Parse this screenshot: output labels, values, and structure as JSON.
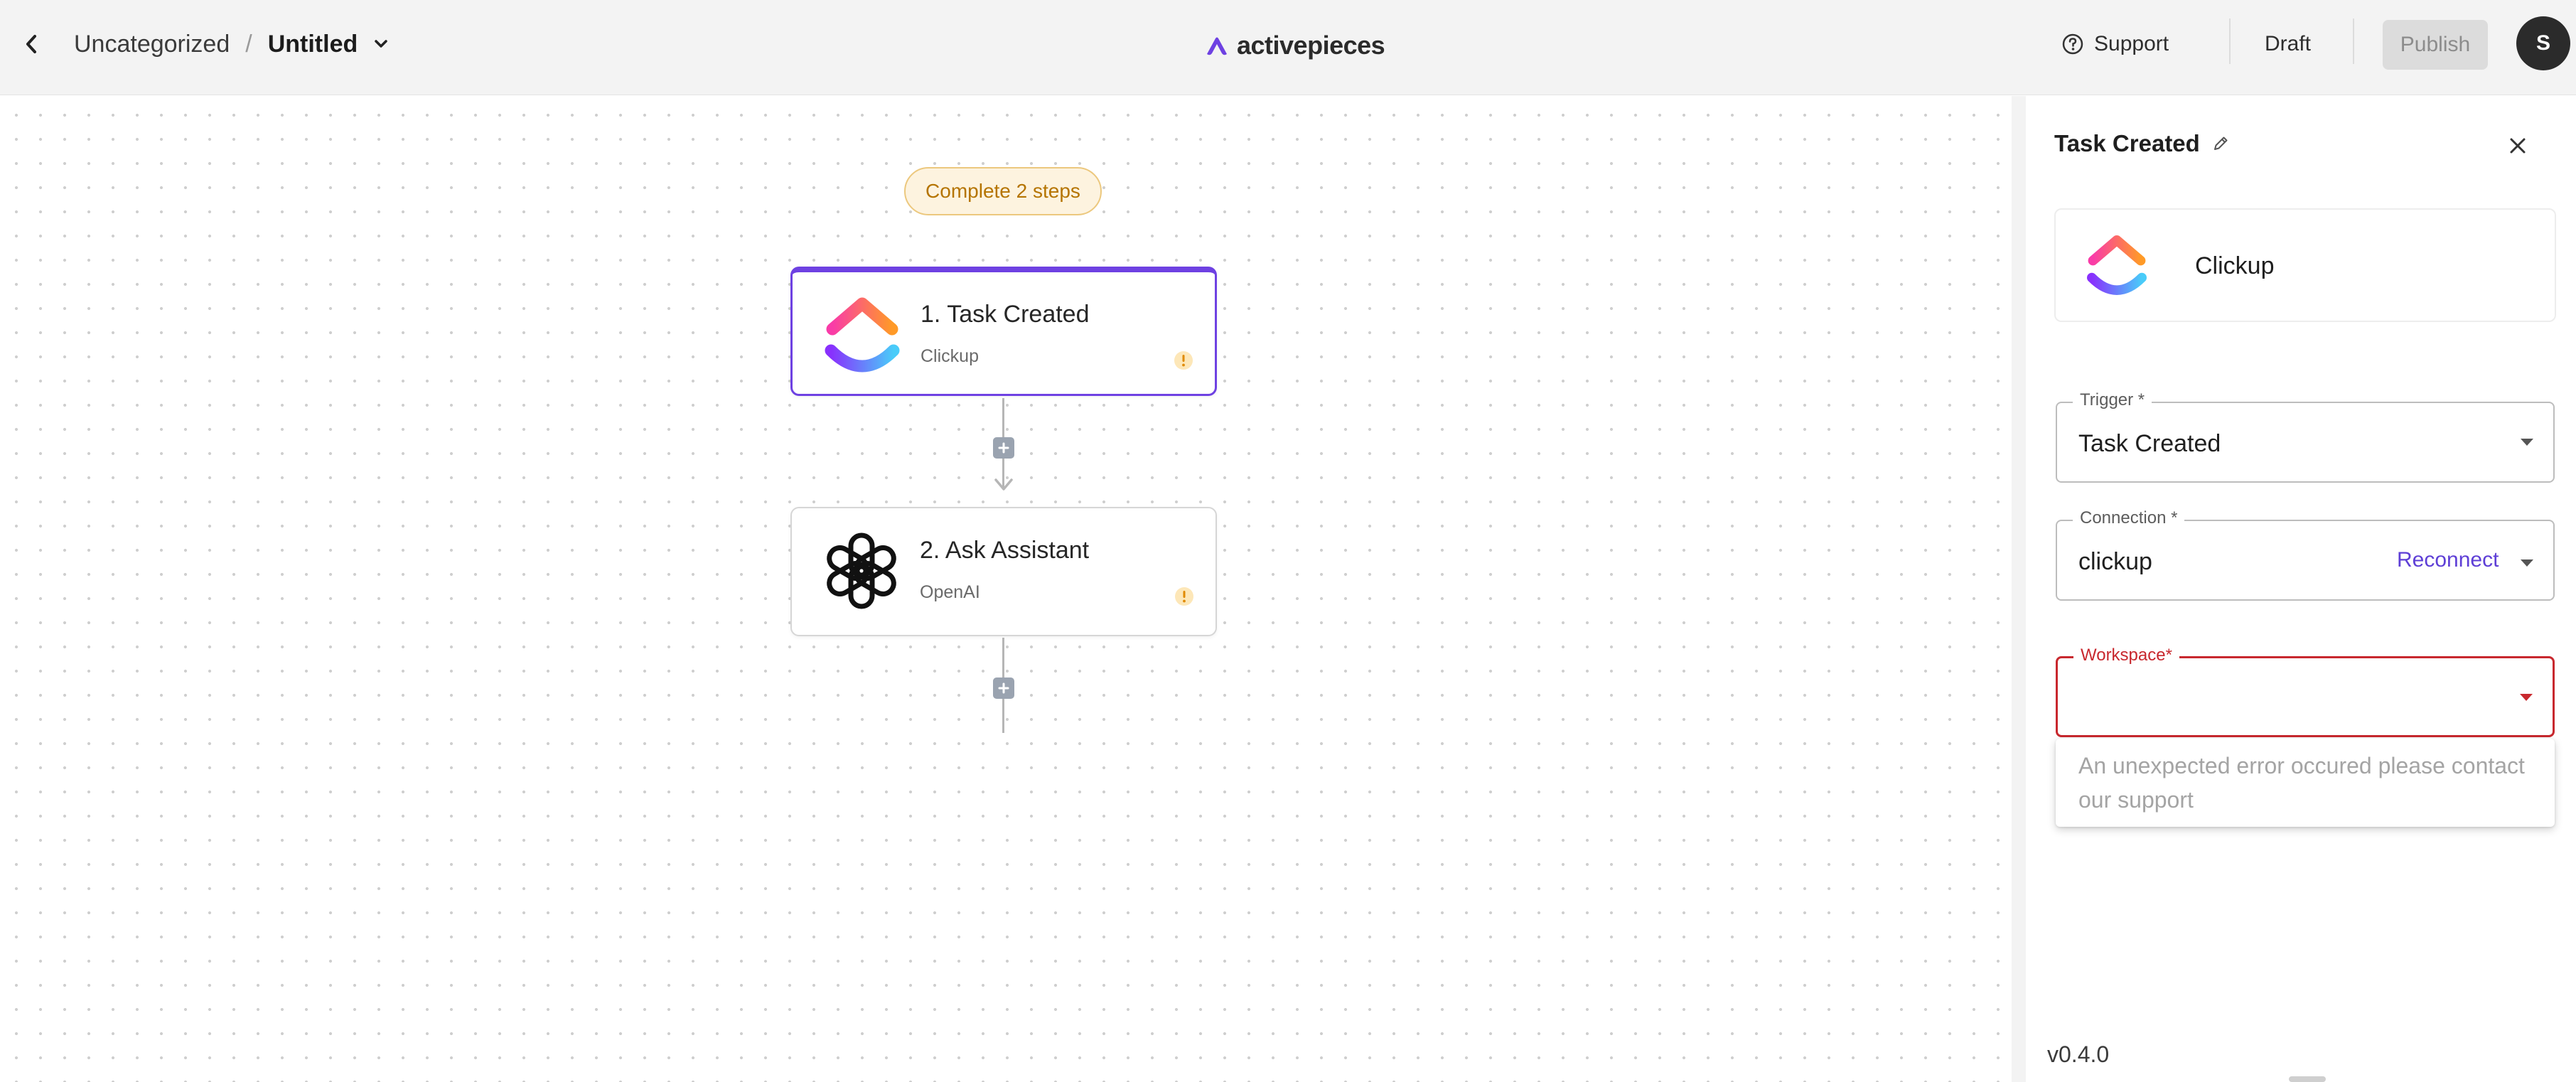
{
  "header": {
    "breadcrumb_folder": "Uncategorized",
    "breadcrumb_separator": "/",
    "flow_name": "Untitled",
    "logo_text": "activepieces",
    "support_label": "Support",
    "status_label": "Draft",
    "publish_label": "Publish",
    "avatar_initial": "S"
  },
  "canvas": {
    "steps_pill": "Complete 2 steps",
    "steps": [
      {
        "title": "1. Task Created",
        "subtitle": "Clickup",
        "icon": "clickup-icon",
        "selected": true,
        "has_warning": true
      },
      {
        "title": "2. Ask Assistant",
        "subtitle": "OpenAI",
        "icon": "openai-icon",
        "selected": false,
        "has_warning": true
      }
    ]
  },
  "panel": {
    "title": "Task Created",
    "piece_name": "Clickup",
    "fields": {
      "trigger": {
        "label": "Trigger *",
        "value": "Task Created"
      },
      "connection": {
        "label": "Connection *",
        "value": "clickup",
        "action": "Reconnect"
      },
      "workspace": {
        "label": "Workspace*",
        "value": "",
        "error": true
      }
    },
    "dropdown_error": "An unexpected error occured please contact our support",
    "version": "v0.4.0"
  },
  "colors": {
    "accent": "#6e41e2",
    "link": "#5e3fd6",
    "error": "#c8282e",
    "warning": "#f0a020",
    "pill_bg": "#fdf3df",
    "pill_text": "#b57400"
  }
}
